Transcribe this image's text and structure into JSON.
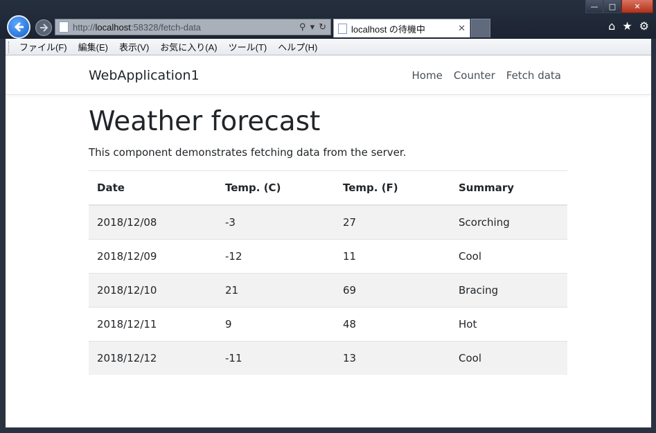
{
  "browser": {
    "url_prefix": "http://",
    "url_host": "localhost",
    "url_rest": ":58328/fetch-data",
    "tab_title": "localhost の待機中",
    "menu": [
      "ファイル(F)",
      "編集(E)",
      "表示(V)",
      "お気に入り(A)",
      "ツール(T)",
      "ヘルプ(H)"
    ]
  },
  "app": {
    "brand": "WebApplication1",
    "nav": [
      "Home",
      "Counter",
      "Fetch data"
    ]
  },
  "page": {
    "title": "Weather forecast",
    "description": "This component demonstrates fetching data from the server."
  },
  "table": {
    "headers": [
      "Date",
      "Temp. (C)",
      "Temp. (F)",
      "Summary"
    ],
    "rows": [
      [
        "2018/12/08",
        "-3",
        "27",
        "Scorching"
      ],
      [
        "2018/12/09",
        "-12",
        "11",
        "Cool"
      ],
      [
        "2018/12/10",
        "21",
        "69",
        "Bracing"
      ],
      [
        "2018/12/11",
        "9",
        "48",
        "Hot"
      ],
      [
        "2018/12/12",
        "-11",
        "13",
        "Cool"
      ]
    ]
  }
}
